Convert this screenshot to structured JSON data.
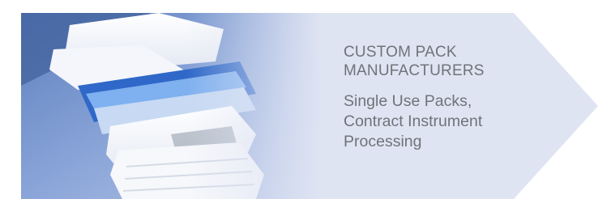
{
  "banner": {
    "heading_lines": [
      "CUSTOM PACK",
      "MANUFACTURERS"
    ],
    "description_lines": [
      "Single Use Packs,",
      "Contract Instrument",
      "Processing"
    ],
    "photo_subject": "surgical-packs-photo",
    "colors": {
      "arrow_panel": "#dfe4f3",
      "text": "#6f7378",
      "photo_blue": "#8fa8d6"
    }
  }
}
